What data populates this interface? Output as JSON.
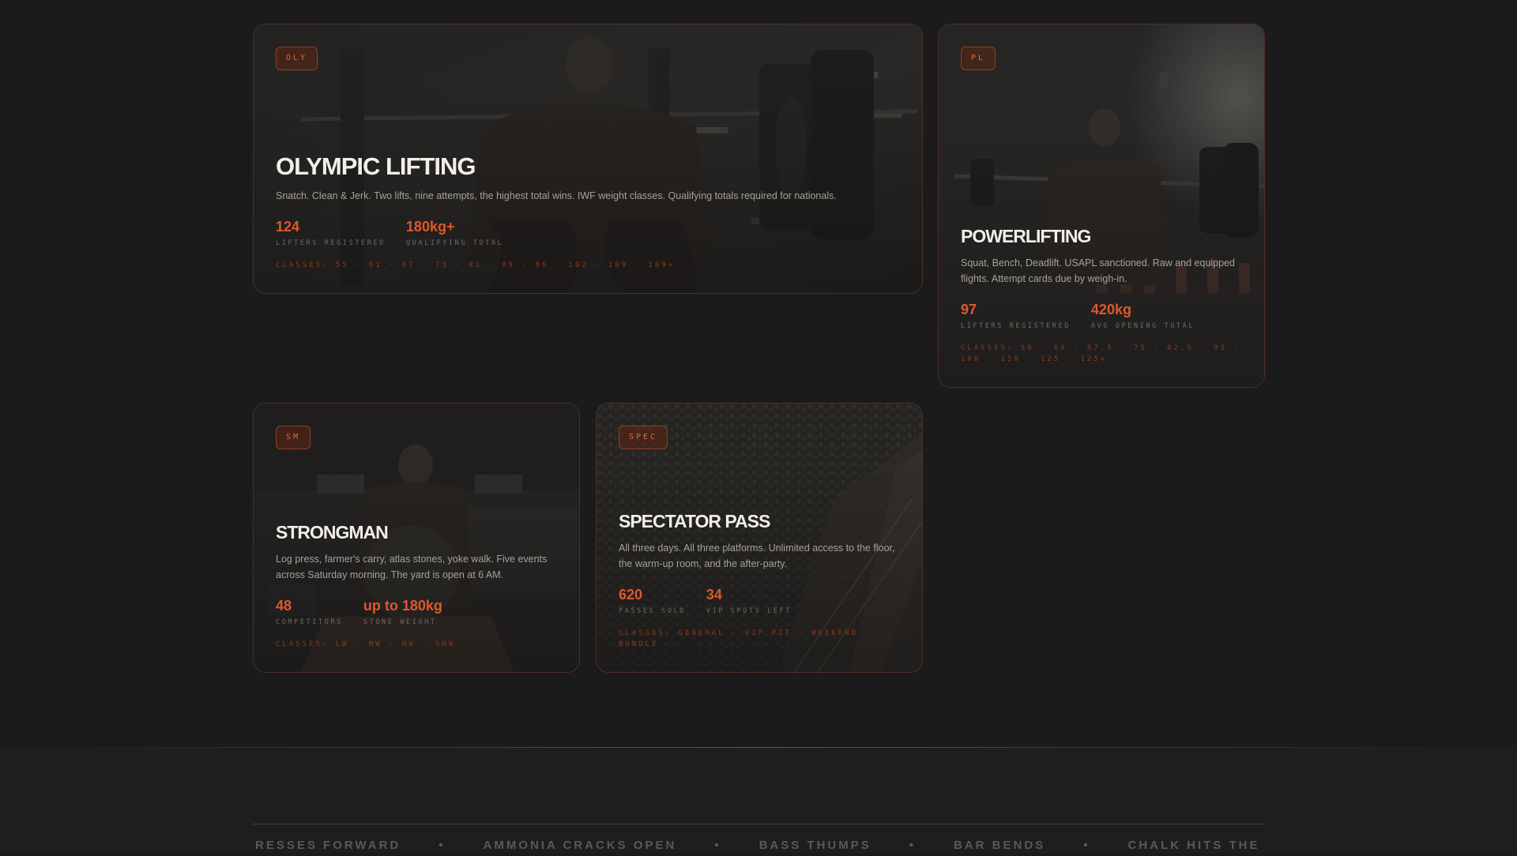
{
  "cards": [
    {
      "badge": "OLY",
      "title": "OLYMPIC LIFTING",
      "description": "Snatch. Clean & Jerk. Two lifts, nine attempts, the highest total wins. IWF weight classes. Qualifying totals required for nationals.",
      "stats": [
        {
          "value": "124",
          "label": "LIFTERS REGISTERED"
        },
        {
          "value": "180kg+",
          "label": "QUALIFYING TOTAL"
        }
      ],
      "classes": "CLASSES: 55 · 61 · 67 · 73 · 81 · 89 · 96 · 102 · 109 · 109+"
    },
    {
      "badge": "PL",
      "title": "POWERLIFTING",
      "description": "Squat, Bench, Deadlift. USAPL sanctioned. Raw and equipped flights. Attempt cards due by weigh-in.",
      "stats": [
        {
          "value": "97",
          "label": "LIFTERS REGISTERED"
        },
        {
          "value": "420kg",
          "label": "AVG OPENING TOTAL"
        }
      ],
      "classes": "CLASSES: 59 · 66 · 67.5 · 75 · 82.5 · 93 · 100 · 110 · 125 · 125+"
    },
    {
      "badge": "SM",
      "title": "STRONGMAN",
      "description": "Log press, farmer's carry, atlas stones, yoke walk. Five events across Saturday morning. The yard is open at 6 AM.",
      "stats": [
        {
          "value": "48",
          "label": "COMPETITORS"
        },
        {
          "value": "up to 180kg",
          "label": "STONE WEIGHT"
        }
      ],
      "classes": "CLASSES: LW · MW · HW · SHW"
    },
    {
      "badge": "SPEC",
      "title": "SPECTATOR PASS",
      "description": "All three days. All three platforms. Unlimited access to the floor, the warm-up room, and the after-party.",
      "stats": [
        {
          "value": "620",
          "label": "PASSES SOLD"
        },
        {
          "value": "34",
          "label": "VIP SPOTS LEFT"
        }
      ],
      "classes": "CLASSES: GENERAL · VIP PIT · WEEKEND BUNDLE"
    }
  ],
  "ticker": {
    "items": [
      "PRESSES FORWARD",
      "AMMONIA CRACKS OPEN",
      "BASS THUMPS",
      "BAR BENDS",
      "CHALK HITS THE AIR"
    ],
    "separator": "•"
  },
  "colors": {
    "background": "#1b1b1b",
    "accent": "#e0582a",
    "badge_text": "#e0683a",
    "card_border": "#3a2a22"
  }
}
